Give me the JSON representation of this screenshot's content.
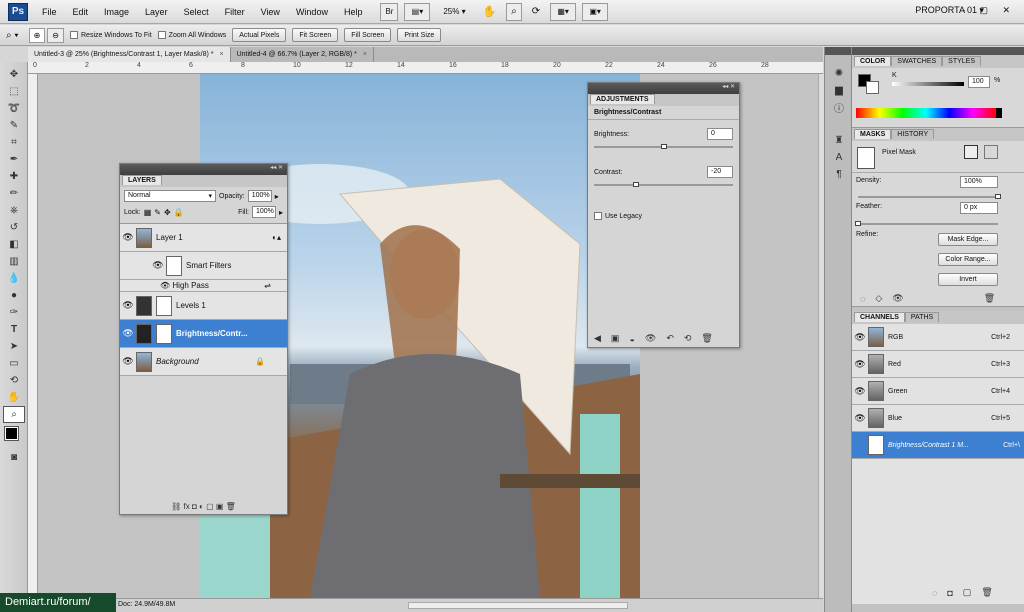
{
  "app": {
    "logo": "Ps"
  },
  "menubar": {
    "items": [
      "File",
      "Edit",
      "Image",
      "Layer",
      "Select",
      "Filter",
      "View",
      "Window",
      "Help"
    ],
    "br_label": "Br",
    "zoom": "25%",
    "workspace": "PROPORTA 01",
    "window_controls": "– ▢ ✕"
  },
  "options_bar": {
    "resize_windows": "Resize Windows To Fit",
    "zoom_all": "Zoom All Windows",
    "actual_pixels": "Actual Pixels",
    "fit_screen": "Fit Screen",
    "fill_screen": "Fill Screen",
    "print_size": "Print Size"
  },
  "doc_tabs": [
    {
      "label": "Untitled-3 @ 25% (Brightness/Contrast 1, Layer Mask/8) *"
    },
    {
      "label": "Untitled-4 @ 66.7% (Layer 2, RGB/8) *"
    }
  ],
  "ruler_numbers": [
    "0",
    "2",
    "4",
    "6",
    "8",
    "10",
    "12",
    "14",
    "16",
    "18",
    "20",
    "22",
    "24",
    "26",
    "28"
  ],
  "status": {
    "doc_size": "Doc: 24.9M/49.8M"
  },
  "layers_panel": {
    "title": "LAYERS",
    "blend_mode": "Normal",
    "opacity_label": "Opacity:",
    "opacity": "100%",
    "lock_label": "Lock:",
    "fill_label": "Fill:",
    "fill": "100%",
    "layers": [
      {
        "name": "Layer 1"
      },
      {
        "name": "Smart Filters"
      },
      {
        "name": "High Pass"
      },
      {
        "name": "Levels 1"
      },
      {
        "name": "Brightness/Contr..."
      },
      {
        "name": "Background"
      }
    ],
    "footer_icons": "⛓ fx ◘ ◐ ▢ ▣ 🗑"
  },
  "adjustments_panel": {
    "title": "ADJUSTMENTS",
    "heading": "Brightness/Contrast",
    "brightness_label": "Brightness:",
    "brightness": "0",
    "contrast_label": "Contrast:",
    "contrast": "-20",
    "legacy_label": "Use Legacy"
  },
  "color_panel": {
    "tabs": [
      "COLOR",
      "SWATCHES",
      "STYLES"
    ],
    "channel": "K",
    "value": "100",
    "unit": "%"
  },
  "masks_panel": {
    "tabs": [
      "MASKS",
      "HISTORY"
    ],
    "mask_type": "Pixel Mask",
    "density_label": "Density:",
    "density": "100%",
    "feather_label": "Feather:",
    "feather": "0 px",
    "refine_label": "Refine:",
    "mask_edge": "Mask Edge...",
    "color_range": "Color Range...",
    "invert": "Invert"
  },
  "channels_panel": {
    "tabs": [
      "CHANNELS",
      "PATHS"
    ],
    "channels": [
      {
        "name": "RGB",
        "shortcut": "Ctrl+2"
      },
      {
        "name": "Red",
        "shortcut": "Ctrl+3"
      },
      {
        "name": "Green",
        "shortcut": "Ctrl+4"
      },
      {
        "name": "Blue",
        "shortcut": "Ctrl+5"
      },
      {
        "name": "Brightness/Contrast 1 M...",
        "shortcut": "Ctrl+\\"
      }
    ]
  },
  "watermark": "Demiart.ru/forum/"
}
